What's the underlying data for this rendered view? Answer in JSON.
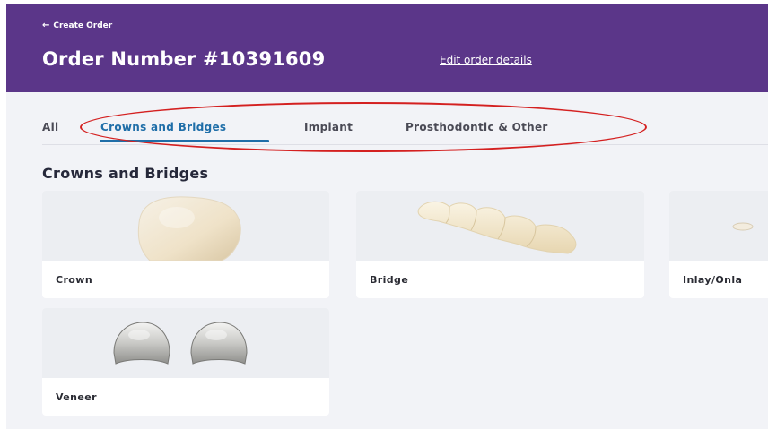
{
  "header": {
    "back_label": "Create Order",
    "back_icon": "arrow-left-icon",
    "title": "Order Number #10391609",
    "edit_link": "Edit order details"
  },
  "tabs": [
    {
      "label": "All",
      "active": false
    },
    {
      "label": "Crowns and Bridges",
      "active": true
    },
    {
      "label": "Implant",
      "active": false
    },
    {
      "label": "Prosthodontic & Other",
      "active": false
    }
  ],
  "section": {
    "title": "Crowns and Bridges"
  },
  "products": [
    {
      "label": "Crown"
    },
    {
      "label": "Bridge"
    },
    {
      "label": "Inlay/Onla"
    },
    {
      "label": "Veneer"
    }
  ],
  "colors": {
    "header_bg": "#5b3689",
    "accent": "#1f6ea8",
    "page_bg": "#f2f3f7",
    "annotation": "#d42020"
  }
}
